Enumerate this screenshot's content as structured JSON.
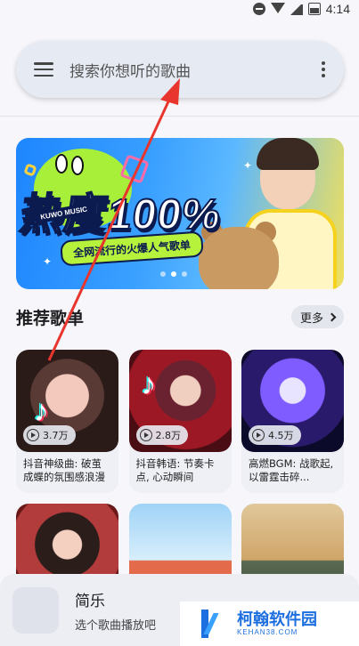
{
  "status_bar": {
    "time": "4:14"
  },
  "search": {
    "placeholder": "搜索你想听的歌曲"
  },
  "banner": {
    "title": "热度100%",
    "badge": "KUWO MUSIC",
    "ribbon": "全网流行的火爆人气歌单",
    "active_slide": 1,
    "slides_visible": 3
  },
  "section": {
    "title": "推荐歌单",
    "more_label": "更多"
  },
  "playlists": [
    {
      "plays": "3.7万",
      "title": "抖音神级曲: 破茧成蝶的氛围感浪漫"
    },
    {
      "plays": "2.8万",
      "title": "抖音韩语: 节奏卡点, 心动瞬间"
    },
    {
      "plays": "4.5万",
      "title": "高燃BGM: 战歌起, 以雷霆击碎..."
    },
    {
      "plays": "",
      "title": ""
    },
    {
      "plays": "",
      "title": ""
    },
    {
      "plays": "",
      "title": ""
    }
  ],
  "player": {
    "title": "简乐",
    "subtitle": "选个歌曲播放吧"
  },
  "watermark": {
    "name": "柯翰软件园",
    "url": "KEHAN38.COM"
  },
  "colors": {
    "accent_red": "#e8362f",
    "banner_blue": "#1e86ff",
    "lime": "#a8ef3a"
  },
  "icons": {
    "menu": "menu-icon",
    "more": "more-vert-icon",
    "play": "play-circle-icon",
    "chevron": "chevron-right-icon"
  }
}
